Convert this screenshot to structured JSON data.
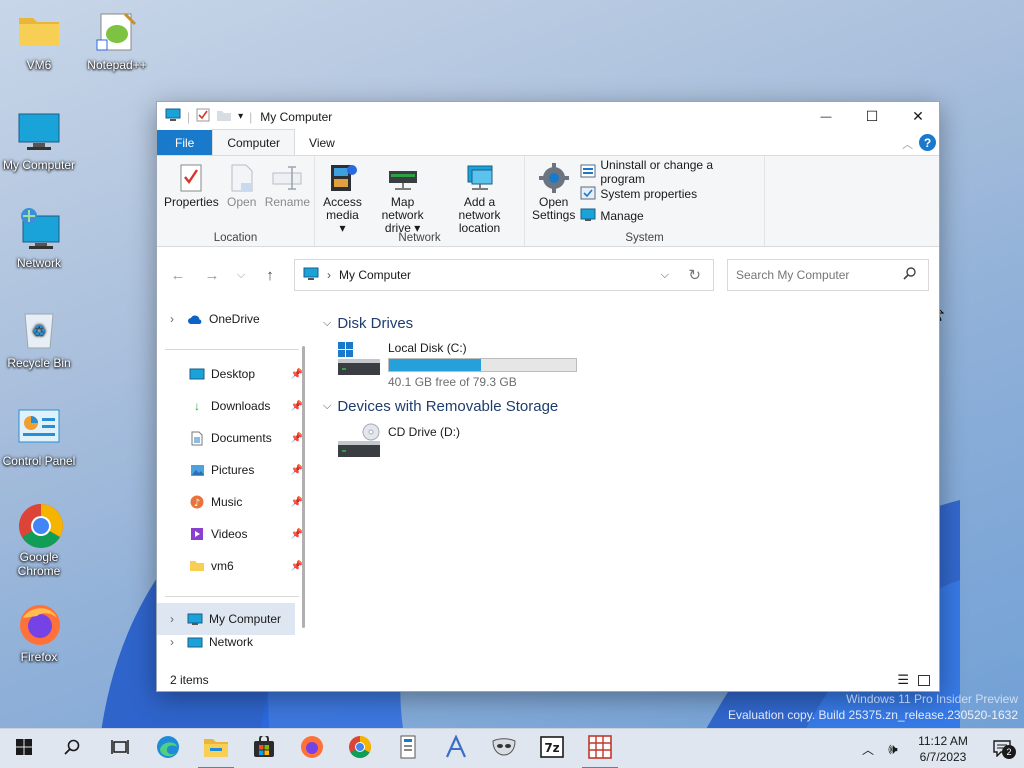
{
  "desktop": {
    "icons": [
      {
        "label": "VM6",
        "icon": "folder-icon"
      },
      {
        "label": "Notepad++",
        "icon": "notepad-plus-plus-icon"
      },
      {
        "label": "My Computer",
        "icon": "monitor-icon"
      },
      {
        "label": "Network",
        "icon": "network-icon"
      },
      {
        "label": "Recycle Bin",
        "icon": "recycle-bin-icon"
      },
      {
        "label": "Control Panel",
        "icon": "control-panel-icon"
      },
      {
        "label": "Google Chrome",
        "icon": "chrome-icon"
      },
      {
        "label": "Firefox",
        "icon": "firefox-icon"
      }
    ]
  },
  "window": {
    "title": "My Computer",
    "controls": {
      "minimize": "—",
      "maximize": "☐",
      "close": "✕"
    }
  },
  "ribbon": {
    "tabs": [
      "File",
      "Computer",
      "View"
    ],
    "active_tab": "Computer",
    "groups": {
      "location": {
        "label": "Location",
        "buttons": {
          "properties": "Properties",
          "open": "Open",
          "rename": "Rename"
        }
      },
      "network": {
        "label": "Network",
        "buttons": {
          "access_media_1": "Access",
          "access_media_2": "media ▾",
          "map_drive_1": "Map network",
          "map_drive_2": "drive ▾",
          "add_location_1": "Add a network",
          "add_location_2": "location"
        }
      },
      "system": {
        "label": "System",
        "buttons": {
          "open_settings_1": "Open",
          "open_settings_2": "Settings",
          "uninstall": "Uninstall or change a program",
          "system_properties": "System properties",
          "manage": "Manage"
        }
      }
    }
  },
  "navbar": {
    "path_item": "My Computer",
    "search_placeholder": "Search My Computer"
  },
  "navpane": {
    "onedrive": "OneDrive",
    "quick": [
      {
        "label": "Desktop",
        "icon": "desktop-folder-icon"
      },
      {
        "label": "Downloads",
        "icon": "downloads-icon"
      },
      {
        "label": "Documents",
        "icon": "documents-icon"
      },
      {
        "label": "Pictures",
        "icon": "pictures-icon"
      },
      {
        "label": "Music",
        "icon": "music-icon"
      },
      {
        "label": "Videos",
        "icon": "videos-icon"
      },
      {
        "label": "vm6",
        "icon": "folder-icon"
      }
    ],
    "my_computer": "My Computer",
    "network": "Network"
  },
  "content": {
    "disk_drives_header": "Disk Drives",
    "local_disk": {
      "name": "Local Disk (C:)",
      "free": "40.1 GB free of 79.3 GB",
      "used_fraction": 0.49
    },
    "removable_header": "Devices with Removable Storage",
    "cd_drive": {
      "name": "CD Drive (D:)"
    }
  },
  "status": {
    "items": "2 items"
  },
  "watermark": {
    "line1": "Windows 11 Pro Insider Preview",
    "line2": "Evaluation copy. Build 25375.zn_release.230520-1632"
  },
  "taskbar": {
    "time": "11:12 AM",
    "date": "6/7/2023",
    "notifications": "2"
  },
  "colors": {
    "accent": "#1979ca",
    "progress": "#26a0da"
  }
}
